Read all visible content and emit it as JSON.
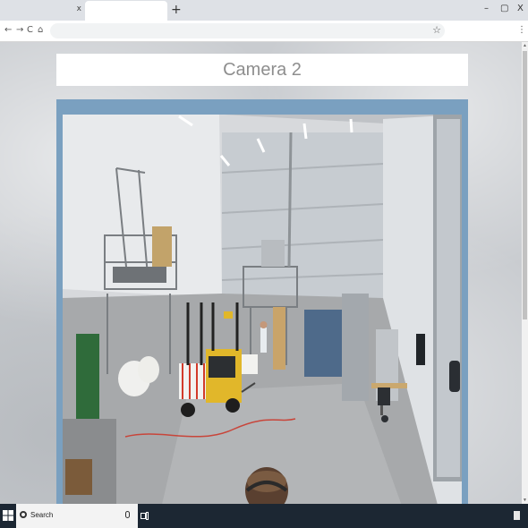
{
  "browser": {
    "tabs": [
      {
        "title": "",
        "close": "x"
      },
      {
        "title": "",
        "close": ""
      }
    ],
    "new_tab": "+",
    "window_controls": {
      "minimize": "–",
      "restore": "▢",
      "close": "X"
    },
    "nav": {
      "back": "←",
      "forward": "→",
      "reload": "C",
      "home": "⌂"
    },
    "address": {
      "value": "",
      "placeholder": ""
    },
    "bookmark": "☆",
    "menu": "⋮"
  },
  "page": {
    "title": "Camera 2"
  },
  "taskbar": {
    "search_placeholder": "Search"
  },
  "colors": {
    "frame": "#7aa0c0",
    "taskbar": "#1c2733",
    "title_text": "#8e8e8e"
  }
}
